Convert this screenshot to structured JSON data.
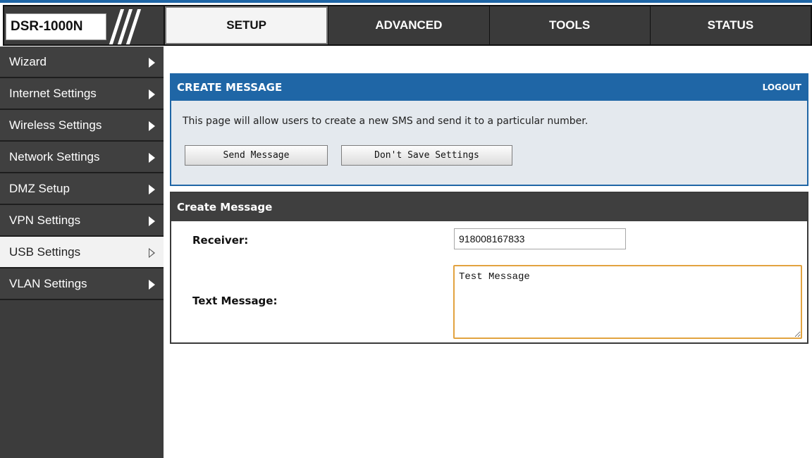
{
  "brand": {
    "model": "DSR-1000N"
  },
  "tabs": [
    {
      "label": "SETUP",
      "active": true
    },
    {
      "label": "ADVANCED",
      "active": false
    },
    {
      "label": "TOOLS",
      "active": false
    },
    {
      "label": "STATUS",
      "active": false
    }
  ],
  "sidebar": {
    "items": [
      {
        "label": "Wizard",
        "icon": "arrow-right-icon"
      },
      {
        "label": "Internet Settings",
        "icon": "arrow-right-icon"
      },
      {
        "label": "Wireless Settings",
        "icon": "arrow-right-icon"
      },
      {
        "label": "Network Settings",
        "icon": "arrow-right-icon"
      },
      {
        "label": "DMZ Setup",
        "icon": "arrow-right-icon"
      },
      {
        "label": "VPN Settings",
        "icon": "arrow-right-icon"
      },
      {
        "label": "USB Settings",
        "icon": "arrow-right-outline-icon",
        "active": true
      },
      {
        "label": "VLAN Settings",
        "icon": "arrow-right-icon"
      }
    ]
  },
  "info": {
    "title": "CREATE MESSAGE",
    "logout": "LOGOUT",
    "description": "This page will allow users to create a new SMS and send it to a particular number.",
    "send_button": "Send Message",
    "no_save_button": "Don't Save Settings"
  },
  "form": {
    "title": "Create Message",
    "receiver_label": "Receiver:",
    "receiver_value": "918008167833",
    "text_label": "Text Message:",
    "text_value": "Test Message"
  },
  "colors": {
    "accent_blue": "#1f66a6",
    "dark_gray": "#3c3c3c",
    "textarea_focus": "#e2a340"
  }
}
